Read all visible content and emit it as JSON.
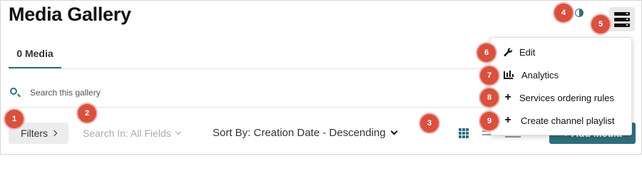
{
  "header": {
    "title": "Media Gallery",
    "contrast_icon": "contrast-icon",
    "menu_icon": "actions-menu-icon"
  },
  "tabs": [
    {
      "label": "0 Media",
      "active": true
    }
  ],
  "search": {
    "placeholder": "Search this gallery",
    "icon": "search-icon"
  },
  "toolbar": {
    "filters_label": "Filters",
    "search_in_label": "Search In: All Fields",
    "sort_label": "Sort By: Creation Date - Descending",
    "view_icons": [
      "grid-view-icon",
      "list-view-icon",
      "compact-view-icon"
    ],
    "add_media_label": "+ Add Media"
  },
  "dropdown_menu": {
    "items": [
      {
        "label": "Edit",
        "icon": "wrench-icon"
      },
      {
        "label": "Analytics",
        "icon": "bar-chart-icon"
      },
      {
        "label": "Services ordering rules",
        "icon": "plus-icon"
      },
      {
        "label": "Create channel playlist",
        "icon": "plus-icon"
      }
    ]
  },
  "badges": [
    "1",
    "2",
    "3",
    "4",
    "5",
    "6",
    "7",
    "8",
    "9"
  ],
  "colors": {
    "accent": "#2f6f7c",
    "badge": "#d9503f",
    "button_bg": "#ececec"
  }
}
